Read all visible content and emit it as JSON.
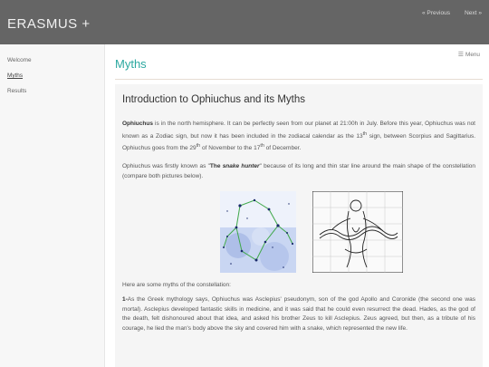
{
  "header": {
    "site_title": "ERASMUS +",
    "prev_label": "« Previous",
    "next_label": "Next »"
  },
  "sidebar": {
    "items": [
      {
        "label": "Welcome"
      },
      {
        "label": "Myths"
      },
      {
        "label": "Results"
      }
    ]
  },
  "main": {
    "page_title": "Myths",
    "menu_label": "Menu",
    "menu_icon": "hamburger-icon",
    "card": {
      "heading": "Introduction to Ophiuchus and its Myths",
      "p1_bold": "Ophiuchus",
      "p1_a": " is in the north hemisphere. It can be perfectly seen from our planet at 21:00h in July. Before this year, Ophiuchus was not known as a Zodiac sign, but now it has been included in the zodiacal calendar as the 13",
      "p1_sup1": "th",
      "p1_b": " sign, between Scorpius and Sagittarius. Ophiuchus goes from the 29",
      "p1_sup2": "th",
      "p1_c": " of November to the 17",
      "p1_sup3": "th",
      "p1_d": " of December.",
      "p2_a": "Ophiuchus was firstly known as \"",
      "p2_bold_a": "The ",
      "p2_bold_italic": "snake hunter",
      "p2_b": "\" because of its long and thin star line around the main shape of the constellation (compare both pictures below).",
      "p3": "Here are some myths of the constellation:",
      "p4_bold": "1-",
      "p4": "As the Greek mythology says, Ophiuchus was Asclepius' pseudonym, son of the god Apollo and Coronide (the second one was mortal). Asclepius developed fantastic skills in medicine, and it was said that he could even resurrect the dead. Hades, as the god of the death, felt dishonoured about that idea, and asked his brother Zeus to kill Asclepius. Zeus agreed, but then, as a tribute of his courage, he lied the man's body above the sky and covered him with a snake, which represented the new life."
    },
    "figures": [
      {
        "name": "star-map"
      },
      {
        "name": "snake-bearer-engraving"
      }
    ]
  },
  "colors": {
    "topbar": "#656565",
    "accent": "#2ca8a0",
    "sidebar_bg": "#f7f7f7",
    "card_bg": "#f5f5f5"
  }
}
